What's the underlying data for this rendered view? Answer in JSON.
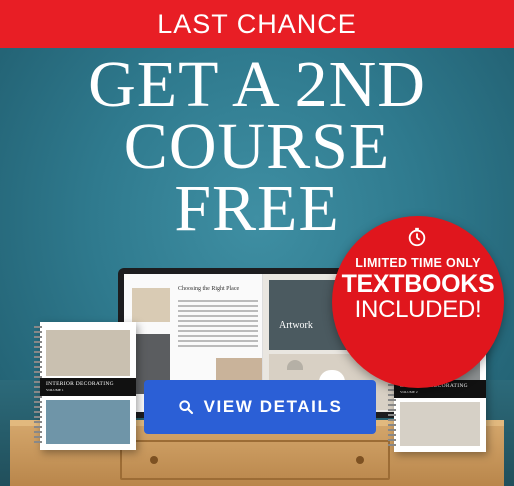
{
  "banner": {
    "text": "LAST CHANCE",
    "bg_color": "#e81e25"
  },
  "headline": {
    "lines": [
      "GET A 2ND",
      "COURSE",
      "FREE"
    ]
  },
  "badge": {
    "line1": "LIMITED TIME ONLY",
    "line2": "TEXTBOOKS",
    "line3": "INCLUDED!",
    "icon": "stopwatch-icon",
    "bg_color": "#e0161d"
  },
  "screen": {
    "left_title": "Choosing the Right Place",
    "right_label": "Artwork"
  },
  "books": [
    {
      "title": "INTERIOR DECORATING",
      "volume": "VOLUME 1"
    },
    {
      "title": "INTERIOR DECORATING",
      "volume": "VOLUME 2"
    }
  ],
  "cta": {
    "label": "VIEW DETAILS",
    "icon": "search-icon",
    "bg_color": "#2b5fd6"
  }
}
